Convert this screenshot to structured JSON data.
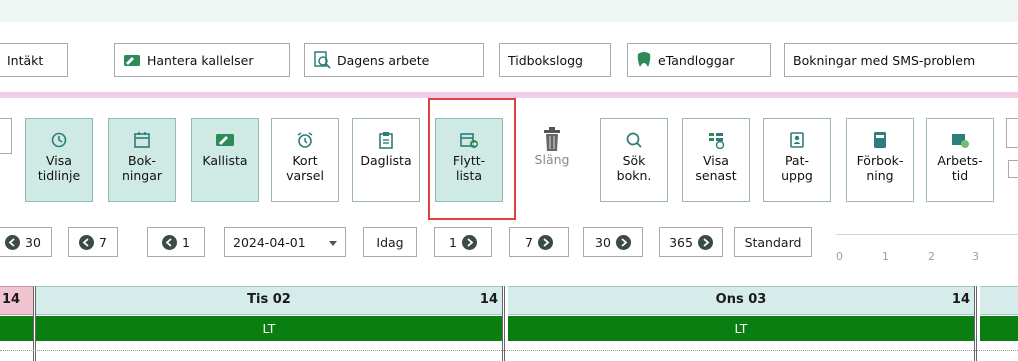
{
  "top_buttons": [
    {
      "label": "Intäkt",
      "icon": null
    },
    {
      "label": "Hantera kallelser",
      "icon": "envelope-edit-icon"
    },
    {
      "label": "Dagens arbete",
      "icon": "document-search-icon"
    },
    {
      "label": "Tidbokslogg",
      "icon": null
    },
    {
      "label": "eTandloggar",
      "icon": "tooth-icon"
    },
    {
      "label": "Bokningar med SMS-problem",
      "icon": null
    }
  ],
  "toolbar": [
    {
      "label": "Visa\ntidlinje",
      "icon": "history-icon",
      "active": true
    },
    {
      "label": "Bok-\nningar",
      "icon": "calendar-icon",
      "active": true
    },
    {
      "label": "Kallista",
      "icon": "envelope-edit-icon",
      "active": true
    },
    {
      "label": "Kort\nvarsel",
      "icon": "alarm-clock-icon",
      "active": false
    },
    {
      "label": "Daglista",
      "icon": "clipboard-icon",
      "active": false
    },
    {
      "label": "Flytt-\nlista",
      "icon": "calendar-move-icon",
      "active": true
    },
    {
      "label": "Släng",
      "icon": "trash-icon",
      "active": false,
      "disabled": true
    },
    {
      "label": "Sök\nbokn.",
      "icon": "search-icon",
      "active": false
    },
    {
      "label": "Visa\nsenast",
      "icon": "recent-list-icon",
      "active": false
    },
    {
      "label": "Pat-\nuppg",
      "icon": "patient-card-icon",
      "active": false
    },
    {
      "label": "Förbok-\nning",
      "icon": "phone-book-icon",
      "active": false
    },
    {
      "label": "Arbets-\ntid",
      "icon": "worktime-icon",
      "active": false
    }
  ],
  "nav": {
    "back_30": "30",
    "back_7": "7",
    "back_1": "1",
    "date": "2024-04-01",
    "today": "Idag",
    "fwd_1": "1",
    "fwd_7": "7",
    "fwd_30": "30",
    "fwd_365": "365",
    "standard": "Standard"
  },
  "scale_ticks": [
    "0",
    "1",
    "2",
    "3"
  ],
  "calendar": {
    "prev_day_num": "14",
    "days": [
      {
        "title": "Tis 02",
        "num": "14",
        "bar": "LT"
      },
      {
        "title": "Ons 03",
        "num": "14",
        "bar": "LT"
      }
    ]
  },
  "colors": {
    "accent_teal": "#cfeae5",
    "highlight_red": "#e0413e",
    "bar_green": "#0b7e12",
    "header_teal": "#d5ecea"
  }
}
